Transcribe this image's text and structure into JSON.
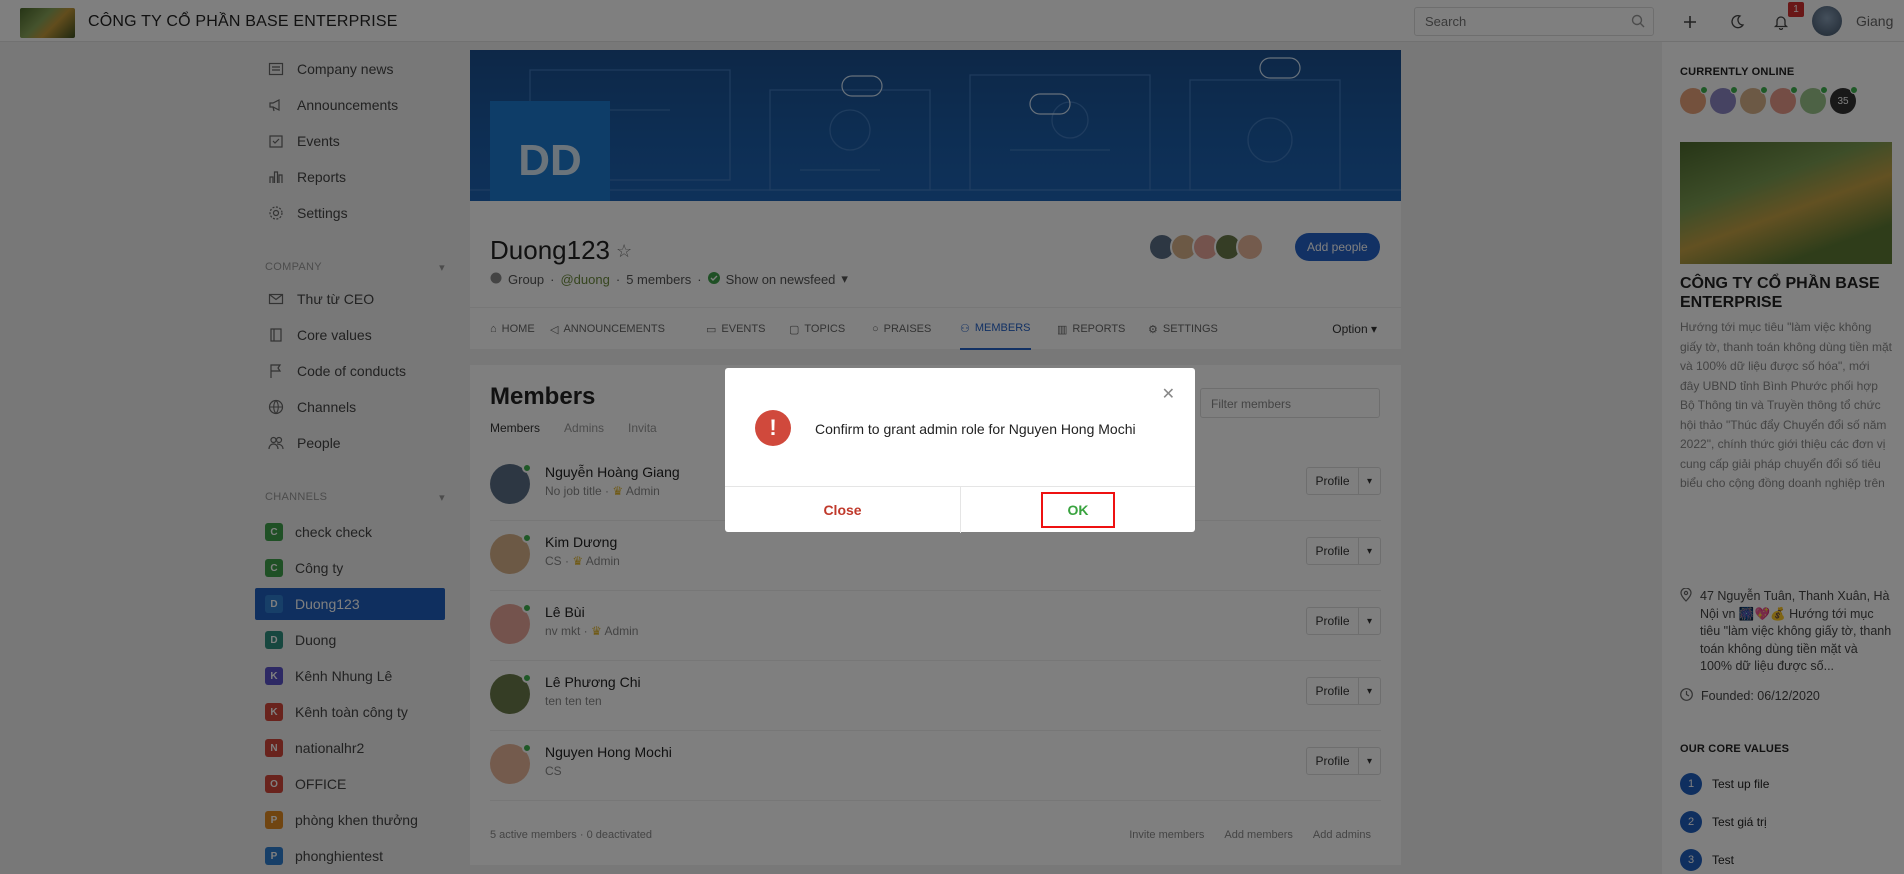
{
  "header": {
    "company_title": "CÔNG TY CỔ PHẦN BASE ENTERPRISE",
    "search_placeholder": "Search",
    "notification_count": "1",
    "user_name": "Giang"
  },
  "sidebar": {
    "top_items": [
      {
        "label": "Company news",
        "icon": "newspaper-icon"
      },
      {
        "label": "Announcements",
        "icon": "megaphone-icon"
      },
      {
        "label": "Events",
        "icon": "calendar-icon"
      },
      {
        "label": "Reports",
        "icon": "bar-chart-icon"
      },
      {
        "label": "Settings",
        "icon": "gear-icon"
      }
    ],
    "company_label": "COMPANY",
    "company_items": [
      {
        "label": "Thư từ CEO",
        "icon": "mail-icon"
      },
      {
        "label": "Core values",
        "icon": "book-icon"
      },
      {
        "label": "Code of conducts",
        "icon": "flag-icon"
      },
      {
        "label": "Channels",
        "icon": "globe-icon"
      },
      {
        "label": "People",
        "icon": "people-icon"
      }
    ],
    "channels_label": "CHANNELS",
    "channels": [
      {
        "letter": "C",
        "label": "check check",
        "color": "#3ea14a"
      },
      {
        "letter": "C",
        "label": "Công ty",
        "color": "#3ea14a"
      },
      {
        "letter": "D",
        "label": "Duong123",
        "color": "#2f7fd1"
      },
      {
        "letter": "D",
        "label": "Duong",
        "color": "#2e8f7e"
      },
      {
        "letter": "K",
        "label": "Kênh Nhung Lê",
        "color": "#5a52c8"
      },
      {
        "letter": "K",
        "label": "Kênh toàn công ty",
        "color": "#d2473a"
      },
      {
        "letter": "N",
        "label": "nationalhr2",
        "color": "#d2473a"
      },
      {
        "letter": "O",
        "label": "OFFICE",
        "color": "#d2473a"
      },
      {
        "letter": "P",
        "label": "phòng khen thưởng",
        "color": "#e08a22"
      },
      {
        "letter": "P",
        "label": "phonghientest",
        "color": "#2f7fd1"
      }
    ]
  },
  "group": {
    "initials": "DD",
    "name": "Duong123",
    "type": "Group",
    "handle": "@duong",
    "members_count": "5 members",
    "newsfeed": "Show on newsfeed",
    "add_people": "Add people",
    "tabs": [
      {
        "label": "HOME",
        "icon": "home-icon"
      },
      {
        "label": "ANNOUNCEMENTS",
        "icon": "megaphone-icon"
      },
      {
        "label": "EVENTS",
        "icon": "calendar-icon"
      },
      {
        "label": "TOPICS",
        "icon": "chat-icon"
      },
      {
        "label": "PRAISES",
        "icon": "medal-icon"
      },
      {
        "label": "MEMBERS",
        "icon": "people-icon"
      },
      {
        "label": "REPORTS",
        "icon": "bar-chart-icon"
      },
      {
        "label": "SETTINGS",
        "icon": "gear-icon"
      }
    ],
    "option": "Option"
  },
  "members": {
    "title": "Members",
    "subtabs": [
      "Members",
      "Admins",
      "Invita"
    ],
    "filter_placeholder": "Filter members",
    "rows": [
      {
        "name": "Nguyễn Hoàng Giang",
        "sub": "No job title",
        "role": "Admin",
        "color": "#5b6f86",
        "online": true
      },
      {
        "name": "Kim Dương",
        "sub": "CS",
        "role": "Admin",
        "color": "#d9b38a",
        "online": true
      },
      {
        "name": "Lê Bùi",
        "sub": "nv mkt",
        "role": "Admin",
        "color": "#e9a79a",
        "online": true
      },
      {
        "name": "Lê Phương Chi",
        "sub": "ten ten ten",
        "role": "",
        "color": "#6b7a4a",
        "online": true
      },
      {
        "name": "Nguyen Hong Mochi",
        "sub": "CS",
        "role": "",
        "color": "#e9b79a",
        "online": true
      }
    ],
    "profile_label": "Profile",
    "footer_status": "5 active members · 0 deactivated",
    "footer_links": [
      "Invite members",
      "Add members",
      "Add admins"
    ]
  },
  "right": {
    "currently_online": "CURRENTLY ONLINE",
    "online_extra": "35",
    "company_name": "CÔNG TY CỔ PHẦN BASE ENTERPRISE",
    "description": "Hướng tới mục tiêu \"làm việc không giấy tờ, thanh toán không dùng tiền mặt và 100% dữ liệu được số hóa\", mới đây UBND tỉnh Bình Phước phối hợp Bộ Thông tin và Truyền thông tổ chức hội thảo \"Thúc đẩy Chuyển đổi số năm 2022\", chính thức giới thiệu các đơn vị cung cấp giải pháp chuyển đổi số tiêu biểu cho cộng đồng doanh nghiệp trên địa bàn tỉnh. Là một trong những đơn vị được lãnh đạo Bình Phước tin tưởng và lựa chọn, Base.vn thu hút sự quan tâm của nhiều doanh nghiệp SMEs. Theo...",
    "address": "47 Nguyễn Tuân, Thanh Xuân, Hà Nội vn 🎆💖💰 Hướng tới mục tiêu \"làm việc không giấy tờ, thanh toán không dùng tiền mặt và 100% dữ liệu được số...",
    "founded": "Founded: 06/12/2020",
    "core_values_label": "OUR CORE VALUES",
    "core_values": [
      {
        "num": "1",
        "label": "Test up file"
      },
      {
        "num": "2",
        "label": "Test giá trị"
      },
      {
        "num": "3",
        "label": "Test"
      }
    ]
  },
  "modal": {
    "message": "Confirm to grant admin role for Nguyen Hong Mochi",
    "close_label": "Close",
    "ok_label": "OK",
    "icon": "exclamation-icon"
  }
}
